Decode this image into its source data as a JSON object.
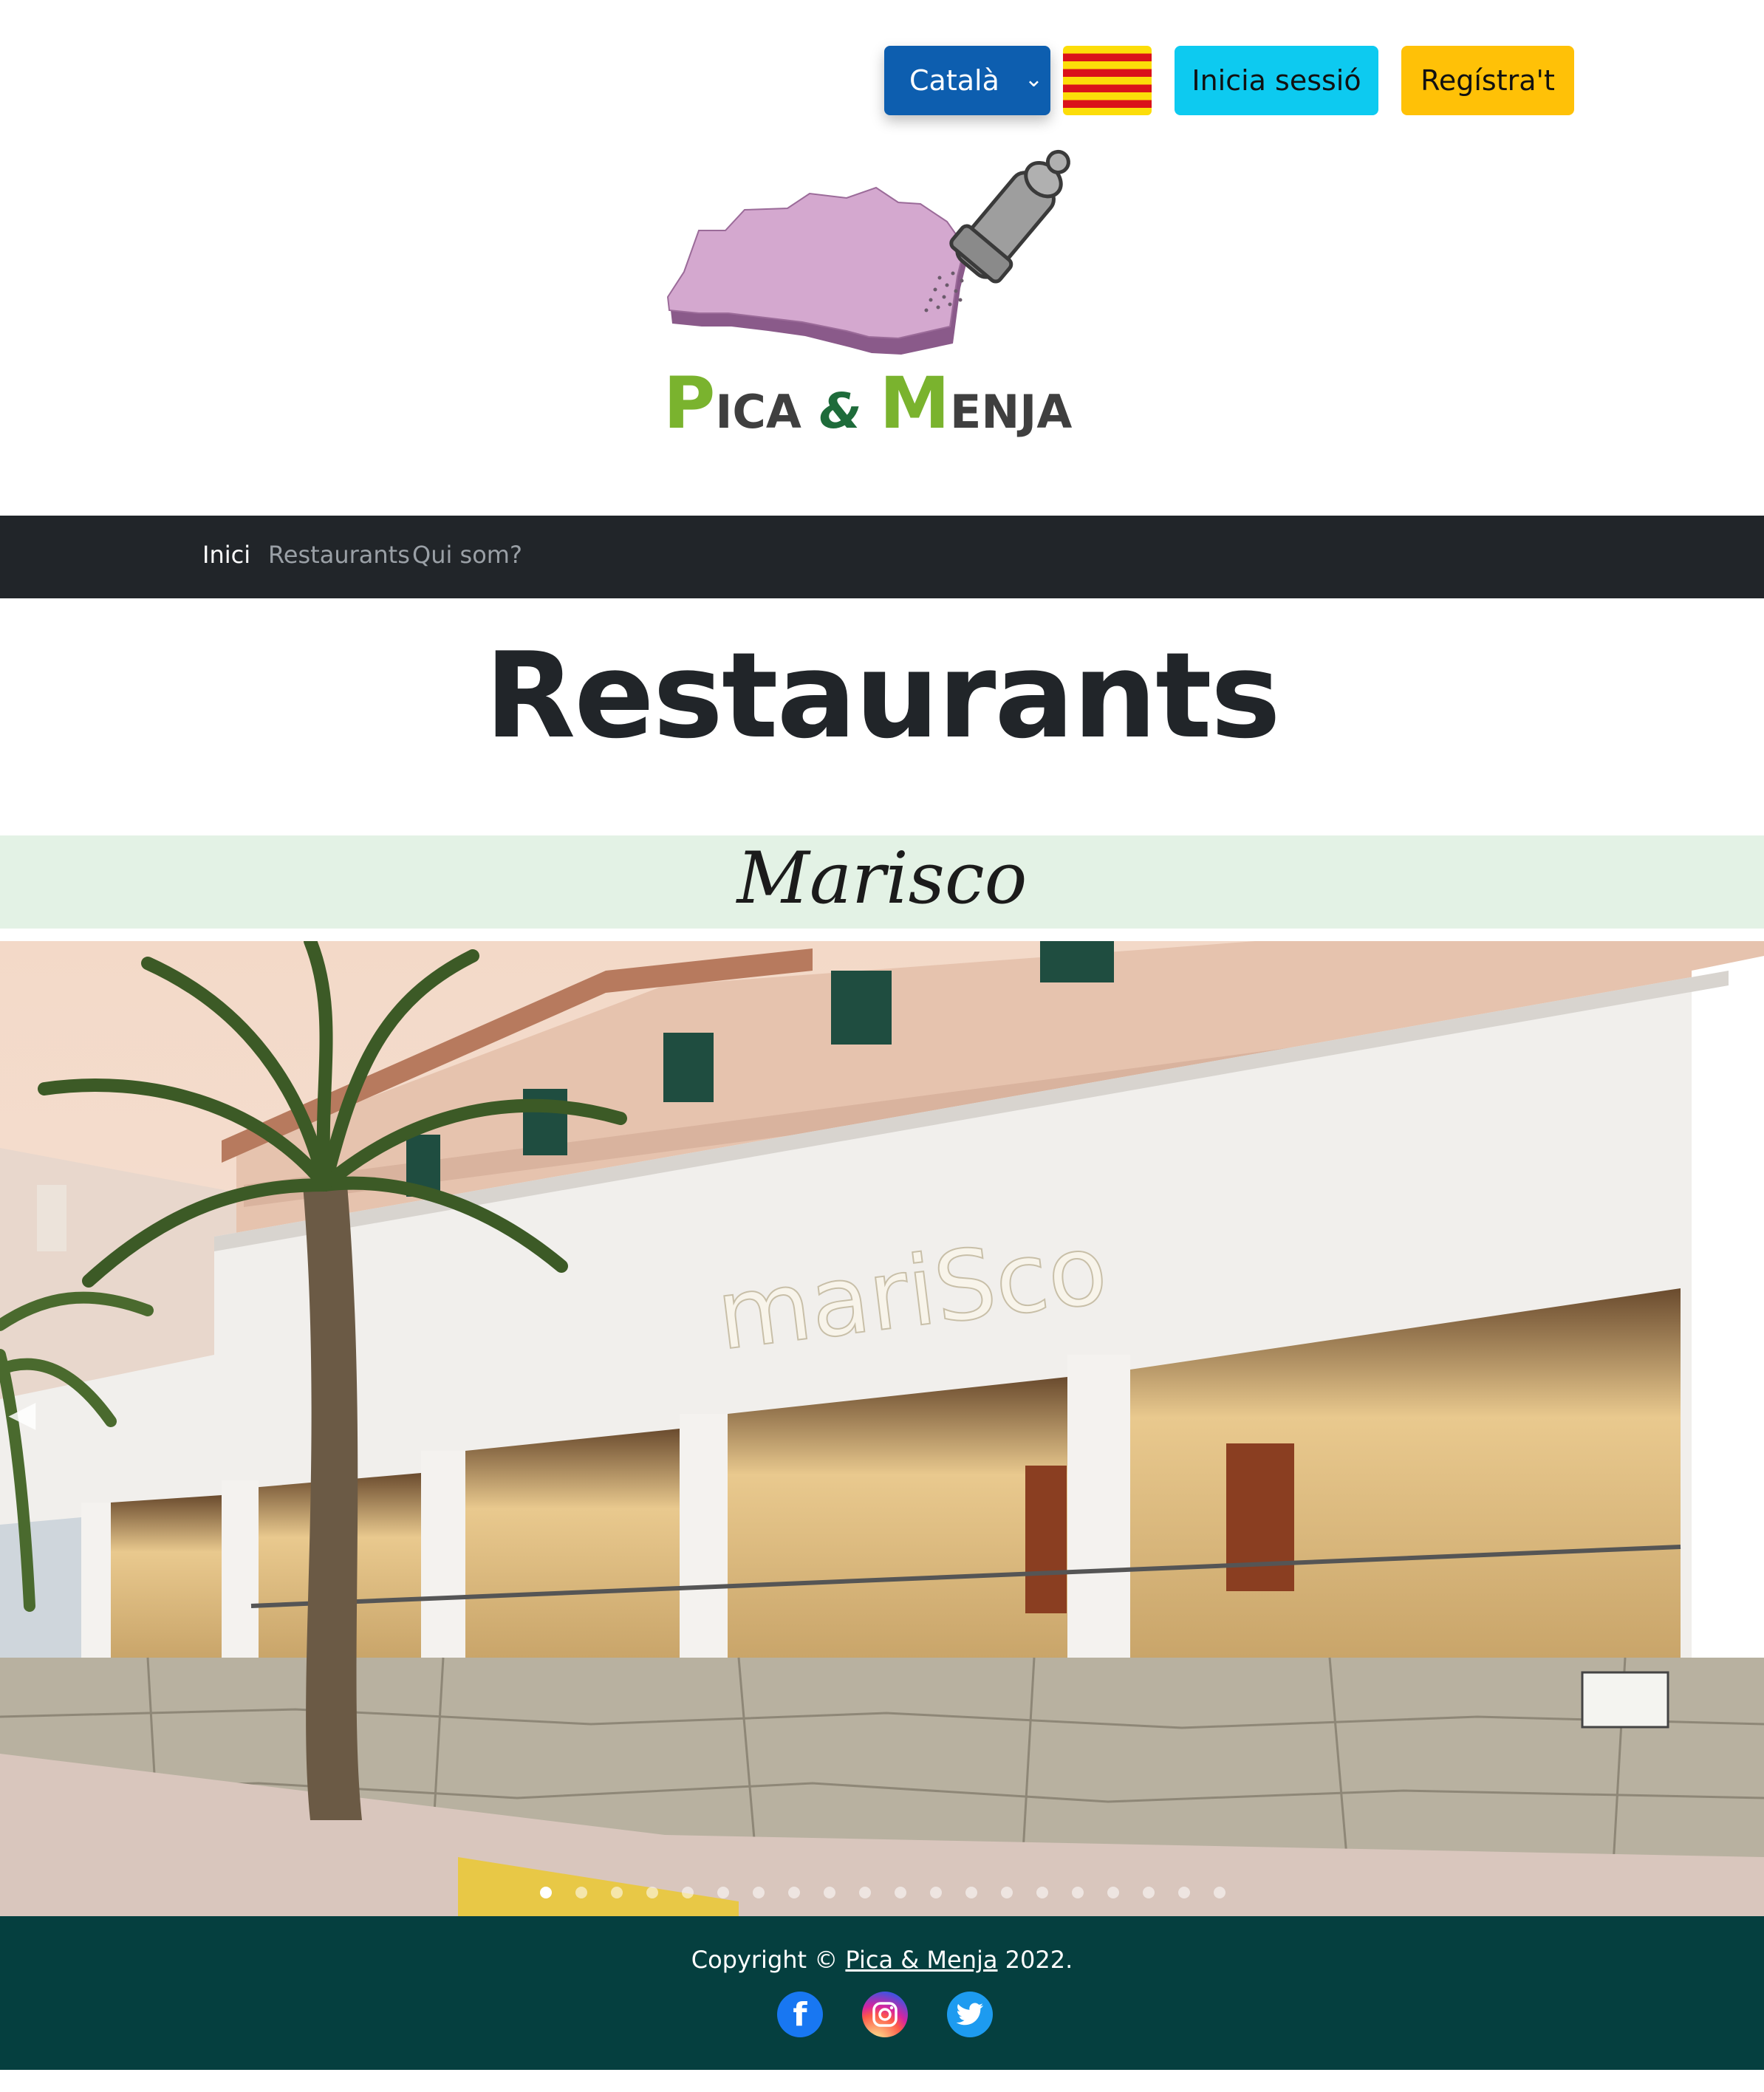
{
  "header": {
    "language": {
      "selected": "Català"
    },
    "login_label": "Inicia sessió",
    "register_label": "Regístra't"
  },
  "logo": {
    "word1_cap": "P",
    "word1_rest": "ICA",
    "ampersand": "&",
    "word2_cap": "M",
    "word2_rest": "ENJA"
  },
  "nav": {
    "items": [
      {
        "label": "Inici",
        "active": true
      },
      {
        "label": "Restaurants",
        "active": false
      },
      {
        "label": "Qui som?",
        "active": false
      }
    ]
  },
  "page": {
    "title": "Restaurants",
    "restaurant_name": "Marisco"
  },
  "carousel": {
    "sign_text": "mariSco",
    "slide_count": 20,
    "active_index": 0,
    "prev_icon": "chevron-left-icon",
    "next_icon": "chevron-right-icon"
  },
  "footer": {
    "copyright_prefix": "Copyright ©",
    "brand_link": "Pica & Menja",
    "year": "2022.",
    "social": [
      "facebook-icon",
      "instagram-icon",
      "twitter-icon"
    ]
  },
  "colors": {
    "navbar": "#212529",
    "footer": "#053f3f",
    "restaurant_band": "#e3f2e5",
    "login_button": "#0dcaf0",
    "register_button": "#ffc107",
    "language_select": "#0d5eaf"
  }
}
